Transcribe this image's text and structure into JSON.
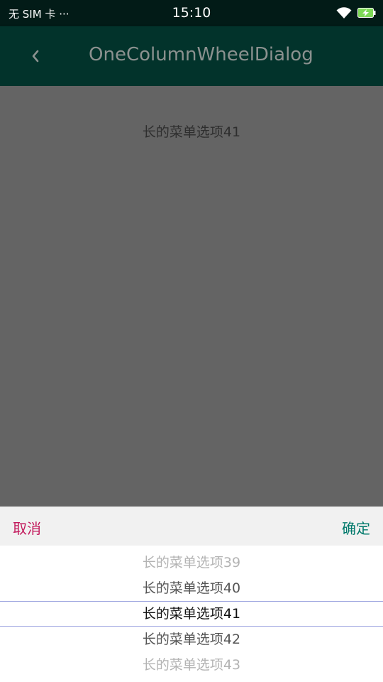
{
  "status_bar": {
    "carrier": "无 SIM 卡 ···",
    "time": "15:10",
    "wifi_icon": "wifi-icon",
    "battery_icon": "battery-charging-icon"
  },
  "app_bar": {
    "back_icon": "chevron-left-icon",
    "title": "OneColumnWheelDialog"
  },
  "content": {
    "selected_value": "长的菜单选项41"
  },
  "dialog": {
    "cancel_label": "取消",
    "confirm_label": "确定",
    "wheel_items": [
      "长的菜单选项39",
      "长的菜单选项40",
      "长的菜单选项41",
      "长的菜单选项42",
      "长的菜单选项43"
    ],
    "colors": {
      "cancel": "#c2185b",
      "confirm": "#00796b",
      "divider": "#9fa6e0"
    }
  }
}
